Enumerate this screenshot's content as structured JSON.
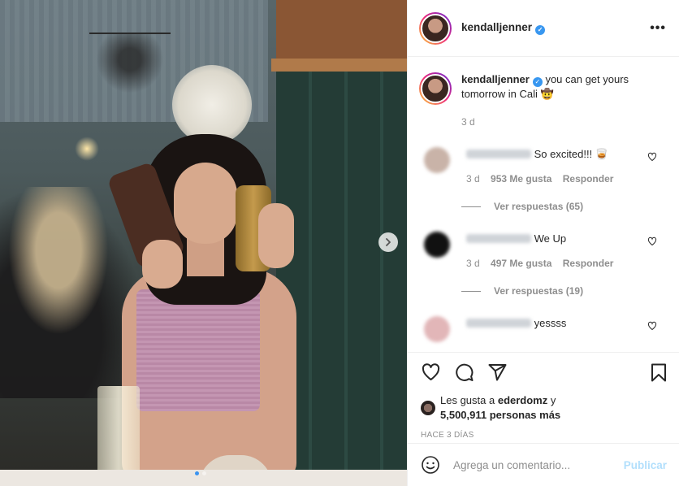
{
  "post": {
    "username": "kendalljenner",
    "verified_symbol": "✓"
  },
  "caption": {
    "username": "kendalljenner",
    "text": "you can get yours tomorrow in Cali",
    "emoji": "🤠",
    "time": "3 d"
  },
  "comments": [
    {
      "text": "So excited!!!",
      "emoji": "🥃",
      "time": "3 d",
      "likes": "953 Me gusta",
      "reply_label": "Responder",
      "replies_label": "Ver respuestas (65)",
      "avatar_color": "#c9b3a8"
    },
    {
      "text": "We Up",
      "emoji": "",
      "time": "3 d",
      "likes": "497 Me gusta",
      "reply_label": "Responder",
      "replies_label": "Ver respuestas (19)",
      "avatar_color": "#111111"
    },
    {
      "text": "yessss",
      "emoji": "",
      "time": "",
      "likes": "",
      "reply_label": "",
      "replies_label": "",
      "avatar_color": "#e2b6b8"
    }
  ],
  "likes": {
    "prefix": "Les gusta a",
    "user": "ederdomz",
    "connector": "y",
    "others": "5,500,911 personas más"
  },
  "posted_time": "HACE 3 DÍAS",
  "composer": {
    "placeholder": "Agrega un comentario...",
    "publish_label": "Publicar"
  },
  "icons": [
    "more-icon",
    "heart-icon",
    "comment-icon",
    "share-icon",
    "bookmark-icon",
    "emoji-icon",
    "chevron-right-icon"
  ],
  "colors": {
    "verified": "#3897f0",
    "publish_disabled": "#b2dffc",
    "muted_text": "#8e8e8e"
  }
}
